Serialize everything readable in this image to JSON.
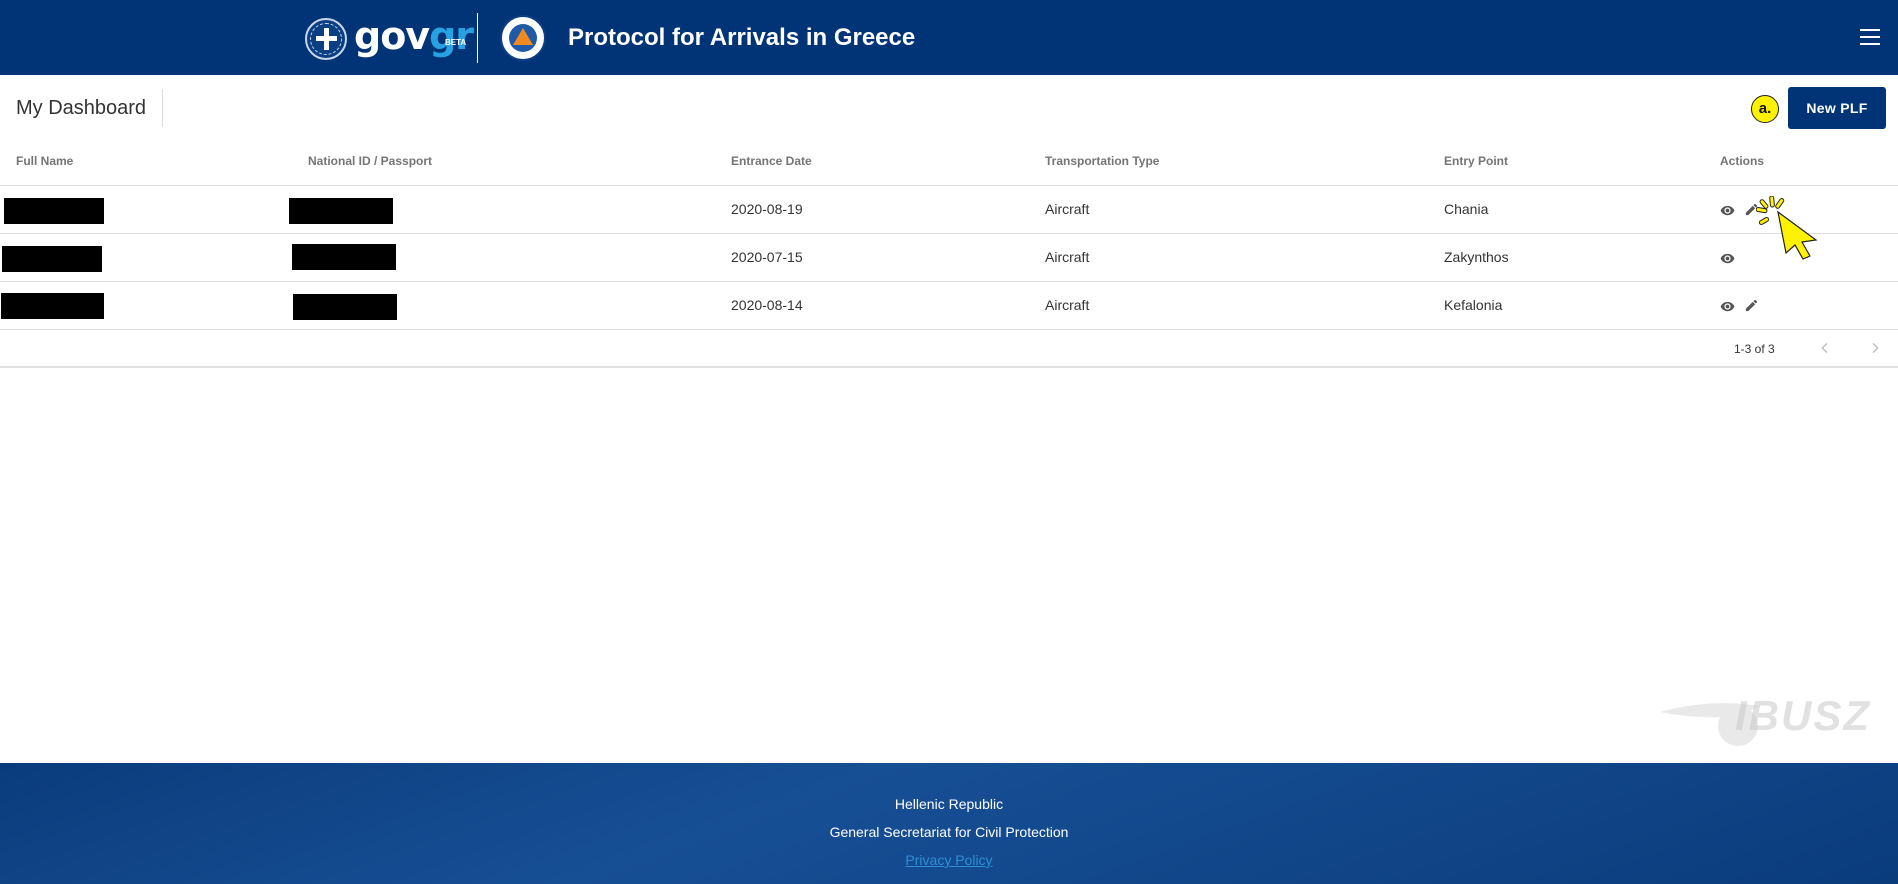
{
  "header": {
    "brand": "gov",
    "brand_accent": "gr",
    "brand_beta": "BETA",
    "title": "Protocol for Arrivals in Greece"
  },
  "dashboard": {
    "title": "My Dashboard",
    "badge": "a.",
    "new_button": "New PLF"
  },
  "table": {
    "columns": [
      "Full Name",
      "National ID / Passport",
      "Entrance Date",
      "Transportation Type",
      "Entry Point",
      "Actions"
    ],
    "rows": [
      {
        "entrance_date": "2020-08-19",
        "transport": "Aircraft",
        "entry_point": "Chania",
        "actions": [
          "view",
          "edit"
        ]
      },
      {
        "entrance_date": "2020-07-15",
        "transport": "Aircraft",
        "entry_point": "Zakynthos",
        "actions": [
          "view"
        ]
      },
      {
        "entrance_date": "2020-08-14",
        "transport": "Aircraft",
        "entry_point": "Kefalonia",
        "actions": [
          "view",
          "edit"
        ]
      }
    ],
    "pagination": {
      "range": "1-3 of 3"
    }
  },
  "footer": {
    "line1": "Hellenic Republic",
    "line2": "General Secretariat for Civil Protection",
    "privacy": "Privacy Policy"
  },
  "watermark": "IBUSZ",
  "colors": {
    "primary": "#003476",
    "accent": "#27a1e2",
    "highlight": "#fff200"
  }
}
